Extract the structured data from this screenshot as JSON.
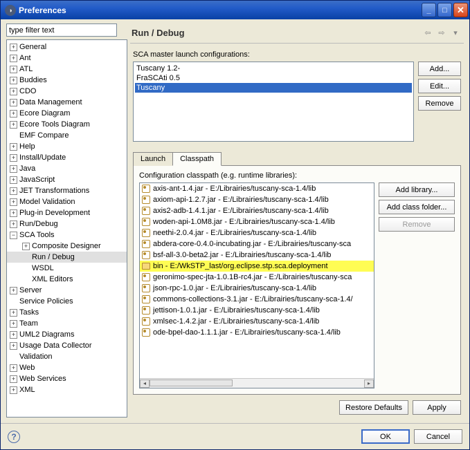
{
  "window": {
    "title": "Preferences"
  },
  "filter": {
    "placeholder": "type filter text"
  },
  "tree": {
    "items": [
      {
        "label": "General",
        "depth": 0,
        "twisty": "+"
      },
      {
        "label": "Ant",
        "depth": 0,
        "twisty": "+"
      },
      {
        "label": "ATL",
        "depth": 0,
        "twisty": "+"
      },
      {
        "label": "Buddies",
        "depth": 0,
        "twisty": "+"
      },
      {
        "label": "CDO",
        "depth": 0,
        "twisty": "+"
      },
      {
        "label": "Data Management",
        "depth": 0,
        "twisty": "+"
      },
      {
        "label": "Ecore Diagram",
        "depth": 0,
        "twisty": "+"
      },
      {
        "label": "Ecore Tools Diagram",
        "depth": 0,
        "twisty": "+"
      },
      {
        "label": "EMF Compare",
        "depth": 0,
        "twisty": ""
      },
      {
        "label": "Help",
        "depth": 0,
        "twisty": "+"
      },
      {
        "label": "Install/Update",
        "depth": 0,
        "twisty": "+"
      },
      {
        "label": "Java",
        "depth": 0,
        "twisty": "+"
      },
      {
        "label": "JavaScript",
        "depth": 0,
        "twisty": "+"
      },
      {
        "label": "JET Transformations",
        "depth": 0,
        "twisty": "+"
      },
      {
        "label": "Model Validation",
        "depth": 0,
        "twisty": "+"
      },
      {
        "label": "Plug-in Development",
        "depth": 0,
        "twisty": "+"
      },
      {
        "label": "Run/Debug",
        "depth": 0,
        "twisty": "+"
      },
      {
        "label": "SCA Tools",
        "depth": 0,
        "twisty": "−"
      },
      {
        "label": "Composite Designer",
        "depth": 1,
        "twisty": "+"
      },
      {
        "label": "Run / Debug",
        "depth": 1,
        "twisty": "",
        "selected": true
      },
      {
        "label": "WSDL",
        "depth": 1,
        "twisty": ""
      },
      {
        "label": "XML Editors",
        "depth": 1,
        "twisty": ""
      },
      {
        "label": "Server",
        "depth": 0,
        "twisty": "+"
      },
      {
        "label": "Service Policies",
        "depth": 0,
        "twisty": ""
      },
      {
        "label": "Tasks",
        "depth": 0,
        "twisty": "+"
      },
      {
        "label": "Team",
        "depth": 0,
        "twisty": "+"
      },
      {
        "label": "UML2 Diagrams",
        "depth": 0,
        "twisty": "+"
      },
      {
        "label": "Usage Data Collector",
        "depth": 0,
        "twisty": "+"
      },
      {
        "label": "Validation",
        "depth": 0,
        "twisty": ""
      },
      {
        "label": "Web",
        "depth": 0,
        "twisty": "+"
      },
      {
        "label": "Web Services",
        "depth": 0,
        "twisty": "+"
      },
      {
        "label": "XML",
        "depth": 0,
        "twisty": "+"
      }
    ]
  },
  "header": {
    "title": "Run / Debug"
  },
  "configs": {
    "label": "SCA master launch configurations:",
    "items": [
      "Tuscany 1.2-",
      "FraSCAti 0.5",
      "Tuscany"
    ],
    "selected": 2,
    "buttons": {
      "add": "Add...",
      "edit": "Edit...",
      "remove": "Remove"
    }
  },
  "tabs": {
    "launch": "Launch",
    "classpath": "Classpath"
  },
  "classpath": {
    "label": "Configuration classpath (e.g. runtime libraries):",
    "items": [
      {
        "text": "axis-ant-1.4.jar - E:/Librairies/tuscany-sca-1.4/lib",
        "icon": "jar"
      },
      {
        "text": "axiom-api-1.2.7.jar - E:/Librairies/tuscany-sca-1.4/lib",
        "icon": "jar"
      },
      {
        "text": "axis2-adb-1.4.1.jar - E:/Librairies/tuscany-sca-1.4/lib",
        "icon": "jar"
      },
      {
        "text": "woden-api-1.0M8.jar - E:/Librairies/tuscany-sca-1.4/lib",
        "icon": "jar"
      },
      {
        "text": "neethi-2.0.4.jar - E:/Librairies/tuscany-sca-1.4/lib",
        "icon": "jar"
      },
      {
        "text": "abdera-core-0.4.0-incubating.jar - E:/Librairies/tuscany-sca",
        "icon": "jar"
      },
      {
        "text": "bsf-all-3.0-beta2.jar - E:/Librairies/tuscany-sca-1.4/lib",
        "icon": "jar"
      },
      {
        "text": "bin - E:/WkSTP_last/org.eclipse.stp.sca.deployment",
        "icon": "folder",
        "hl": true
      },
      {
        "text": "geronimo-spec-jta-1.0.1B-rc4.jar - E:/Librairies/tuscany-sca",
        "icon": "jar"
      },
      {
        "text": "json-rpc-1.0.jar - E:/Librairies/tuscany-sca-1.4/lib",
        "icon": "jar"
      },
      {
        "text": "commons-collections-3.1.jar - E:/Librairies/tuscany-sca-1.4/",
        "icon": "jar"
      },
      {
        "text": "jettison-1.0.1.jar - E:/Librairies/tuscany-sca-1.4/lib",
        "icon": "jar"
      },
      {
        "text": "xmlsec-1.4.2.jar - E:/Librairies/tuscany-sca-1.4/lib",
        "icon": "jar"
      },
      {
        "text": "ode-bpel-dao-1.1.1.jar - E:/Librairies/tuscany-sca-1.4/lib",
        "icon": "jar"
      }
    ],
    "buttons": {
      "addlib": "Add library...",
      "addfolder": "Add class folder...",
      "remove": "Remove"
    }
  },
  "footer": {
    "restore": "Restore Defaults",
    "apply": "Apply"
  },
  "dialog": {
    "ok": "OK",
    "cancel": "Cancel"
  }
}
